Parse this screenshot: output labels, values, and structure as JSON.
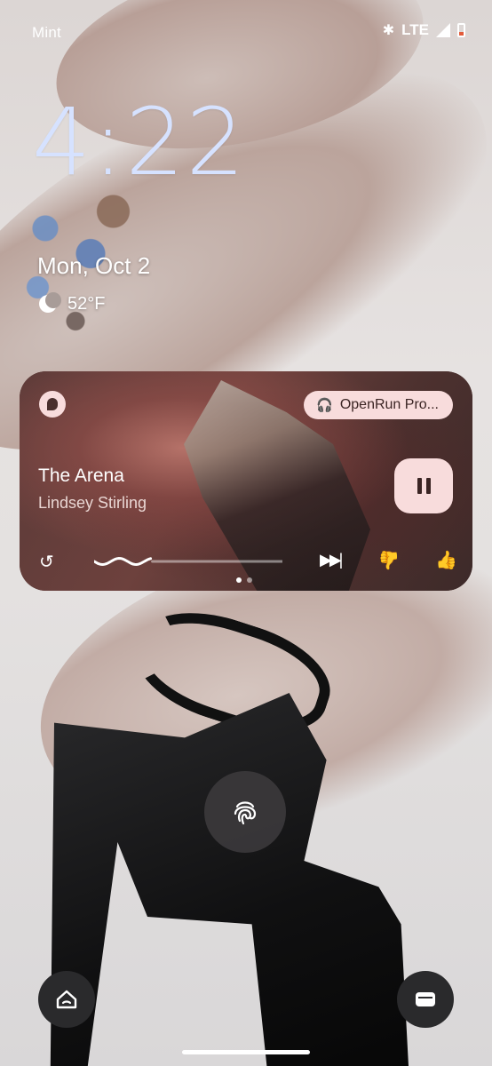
{
  "status_bar": {
    "carrier": "Mint",
    "network": "LTE",
    "icons": [
      "bluetooth-icon",
      "signal-icon",
      "battery-icon"
    ],
    "battery_color": "#e25b3a"
  },
  "lockscreen": {
    "time": "4:22",
    "date": "Mon, Oct 2",
    "weather": {
      "icon": "moon-cloud-icon",
      "temperature": "52°F"
    }
  },
  "media_player": {
    "app_icon": "pandora-icon",
    "output_device": "OpenRun Pro...",
    "track_title": "The Arena",
    "artist": "Lindsey Stirling",
    "state": "playing",
    "progress": 0.3,
    "page_indicator": {
      "pages": 2,
      "active": 0
    },
    "controls": [
      "replay-icon",
      "pause-icon",
      "skip-next-icon",
      "thumbs-down-icon",
      "thumbs-up-icon"
    ],
    "accent_color": "#f8dcdc",
    "card_color": "#4a2f2d"
  },
  "bottom": {
    "left_shortcut": "home-icon",
    "right_shortcut": "wallet-icon",
    "center": "fingerprint-icon"
  },
  "colors": {
    "clock": "#d6e2ff"
  }
}
